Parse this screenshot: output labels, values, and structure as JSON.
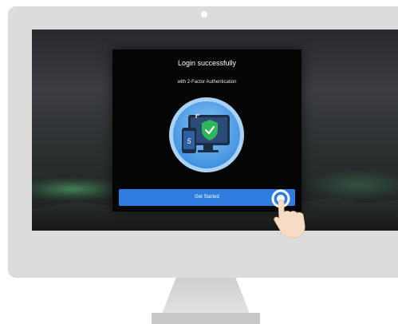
{
  "dialog": {
    "title": "Login successfully",
    "subtitle": "with 2-Factor Authentication",
    "button_label": "Get Started",
    "illustration_icons": [
      "phone-icon",
      "monitor-icon",
      "shield-check-icon"
    ]
  },
  "colors": {
    "button": "#2f7de0",
    "dialog_bg": "#050505",
    "illustration_circle": "#4b9be8",
    "shield": "#2fb55a",
    "bezel": "#dcdcdc"
  }
}
